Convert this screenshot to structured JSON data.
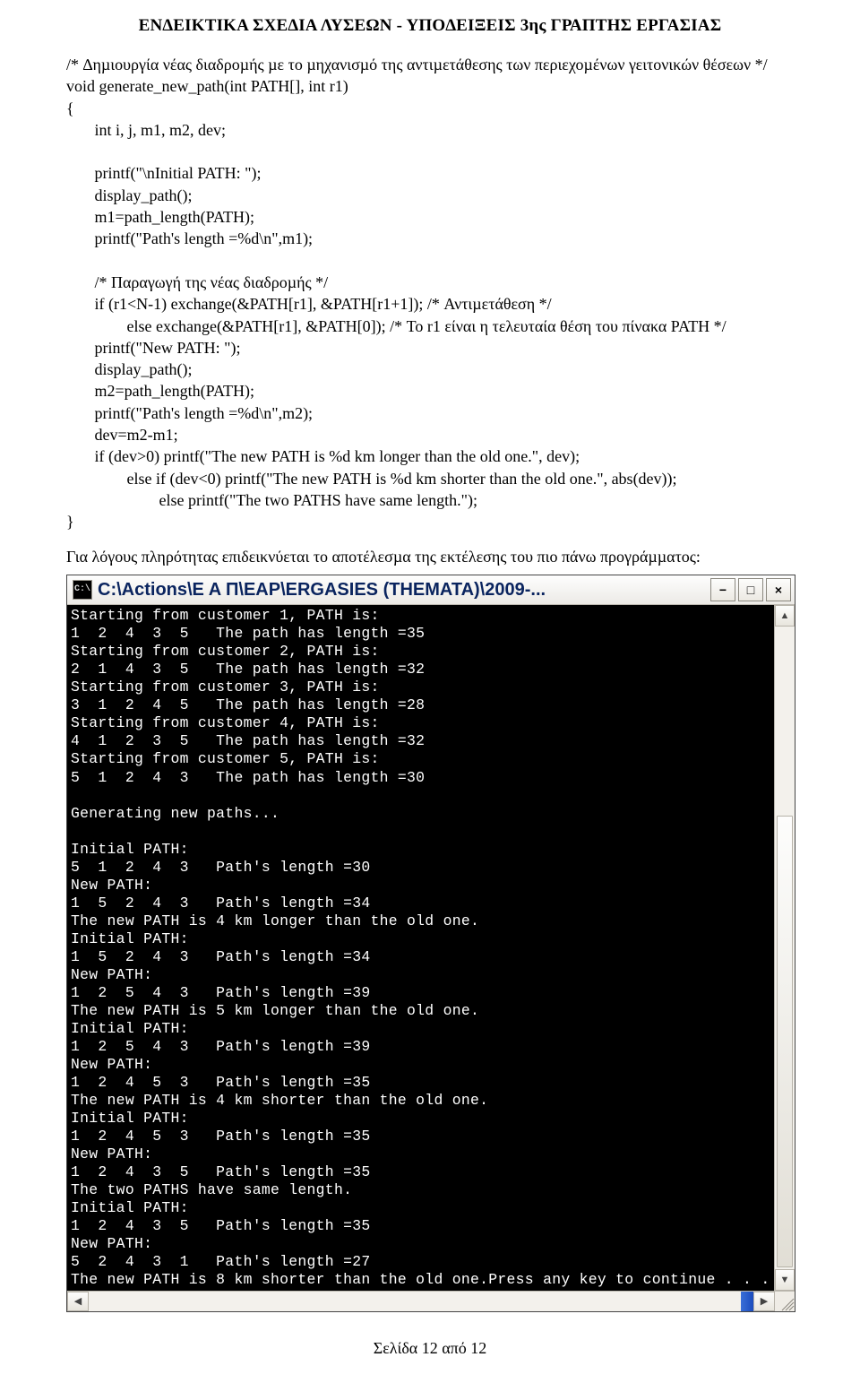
{
  "header": {
    "title": "ΕΝ∆ΕΙΚΤΙΚΑ ΣΧΕ∆ΙΑ ΛΥΣΕΩΝ - ΥΠΟ∆ΕΙΞΕΙΣ 3ης ΓΡΑΠΤΗΣ ΕΡΓΑΣΙΑΣ"
  },
  "code": "/* ∆ηµιουργία νέας διαδροµής µε το µηχανισµό της αντιµετάθεσης των περιεχοµένων γειτονικών θέσεων */\nvoid generate_new_path(int PATH[], int r1)\n{\n       int i, j, m1, m2, dev;\n\n       printf(\"\\nInitial PATH: \");\n       display_path();\n       m1=path_length(PATH);\n       printf(\"Path's length =%d\\n\",m1);\n\n       /* Παραγωγή της νέας διαδροµής */\n       if (r1<N-1) exchange(&PATH[r1], &PATH[r1+1]); /* Αντιµετάθεση */\n               else exchange(&PATH[r1], &PATH[0]); /* Το r1 είναι η τελευταία θέση του πίνακα PATH */\n       printf(\"New PATH: \");\n       display_path();\n       m2=path_length(PATH);\n       printf(\"Path's length =%d\\n\",m2);\n       dev=m2-m1;\n       if (dev>0) printf(\"The new PATH is %d km longer than the old one.\", dev);\n               else if (dev<0) printf(\"The new PATH is %d km shorter than the old one.\", abs(dev));\n                       else printf(\"The two PATHS have same length.\");\n}",
  "narrative": "Για λόγους πληρότητας επιδεικνύεται το αποτέλεσµα της εκτέλεσης του πιο πάνω προγράµµατος:",
  "terminal": {
    "title": "C:\\Actions\\E A Π\\EAP\\ERGASIES (THEMATA)\\2009-...",
    "icon": "C:\\",
    "buttons": {
      "min": "−",
      "max": "□",
      "close": "×"
    },
    "output": "Starting from customer 1, PATH is:\n1  2  4  3  5   The path has length =35\nStarting from customer 2, PATH is:\n2  1  4  3  5   The path has length =32\nStarting from customer 3, PATH is:\n3  1  2  4  5   The path has length =28\nStarting from customer 4, PATH is:\n4  1  2  3  5   The path has length =32\nStarting from customer 5, PATH is:\n5  1  2  4  3   The path has length =30\n\nGenerating new paths...\n\nInitial PATH:\n5  1  2  4  3   Path's length =30\nNew PATH:\n1  5  2  4  3   Path's length =34\nThe new PATH is 4 km longer than the old one.\nInitial PATH:\n1  5  2  4  3   Path's length =34\nNew PATH:\n1  2  5  4  3   Path's length =39\nThe new PATH is 5 km longer than the old one.\nInitial PATH:\n1  2  5  4  3   Path's length =39\nNew PATH:\n1  2  4  5  3   Path's length =35\nThe new PATH is 4 km shorter than the old one.\nInitial PATH:\n1  2  4  5  3   Path's length =35\nNew PATH:\n1  2  4  3  5   Path's length =35\nThe two PATHS have same length.\nInitial PATH:\n1  2  4  3  5   Path's length =35\nNew PATH:\n5  2  4  3  1   Path's length =27\nThe new PATH is 8 km shorter than the old one.Press any key to continue . . ."
  },
  "footer": {
    "text": "Σελίδα 12 από 12"
  }
}
